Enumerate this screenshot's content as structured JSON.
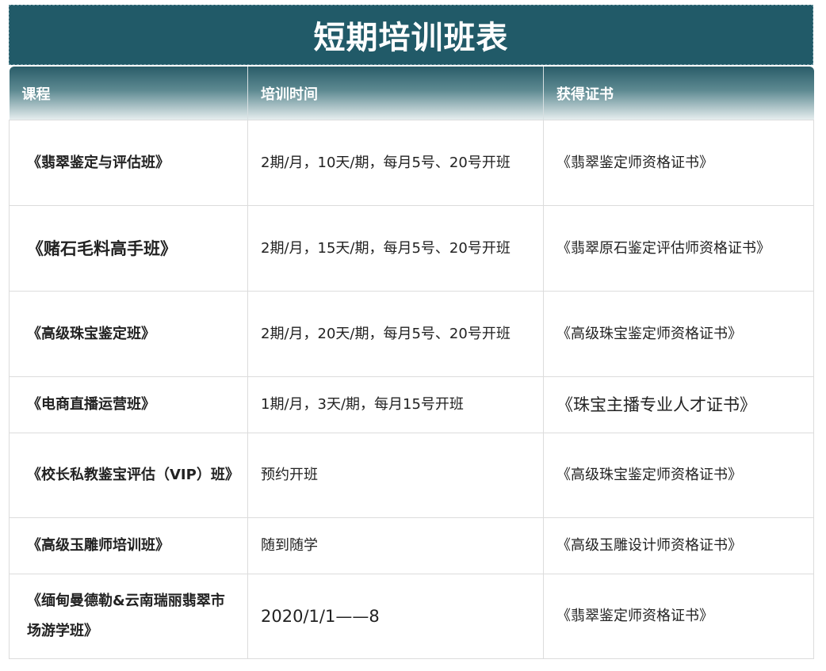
{
  "page": {
    "title": "短期培训班表"
  },
  "table": {
    "headers": [
      "课程",
      "培训时间",
      "获得证书"
    ],
    "rows": [
      {
        "course": "《翡翠鉴定与评估班》",
        "time": "2期/月，10天/期，每月5号、20号开班",
        "cert": "《翡翠鉴定师资格证书》"
      },
      {
        "course": "《赌石毛料高手班》",
        "time": "2期/月，15天/期，每月5号、20号开班",
        "cert": "《翡翠原石鉴定评估师资格证书》"
      },
      {
        "course": "《高级珠宝鉴定班》",
        "time": "2期/月，20天/期，每月5号、20号开班",
        "cert": "《高级珠宝鉴定师资格证书》"
      },
      {
        "course": "《电商直播运营班》",
        "time": "1期/月，3天/期，每月15号开班",
        "cert": "《珠宝主播专业人才证书》"
      },
      {
        "course": "《校长私教鉴宝评估（VIP）班》",
        "time": "预约开班",
        "cert": "《高级珠宝鉴定师资格证书》"
      },
      {
        "course": "《高级玉雕师培训班》",
        "time": "随到随学",
        "cert": "《高级玉雕设计师资格证书》"
      },
      {
        "course": "《缅甸曼德勒&云南瑞丽翡翠市场游学班》",
        "time": "2020/1/1——8",
        "cert": "《翡翠鉴定师资格证书》"
      }
    ]
  },
  "colors": {
    "title_bg": "#215a68",
    "header_top": "#2a5d69",
    "header_bottom": "#e6eeef",
    "border": "#dcdcdc"
  }
}
